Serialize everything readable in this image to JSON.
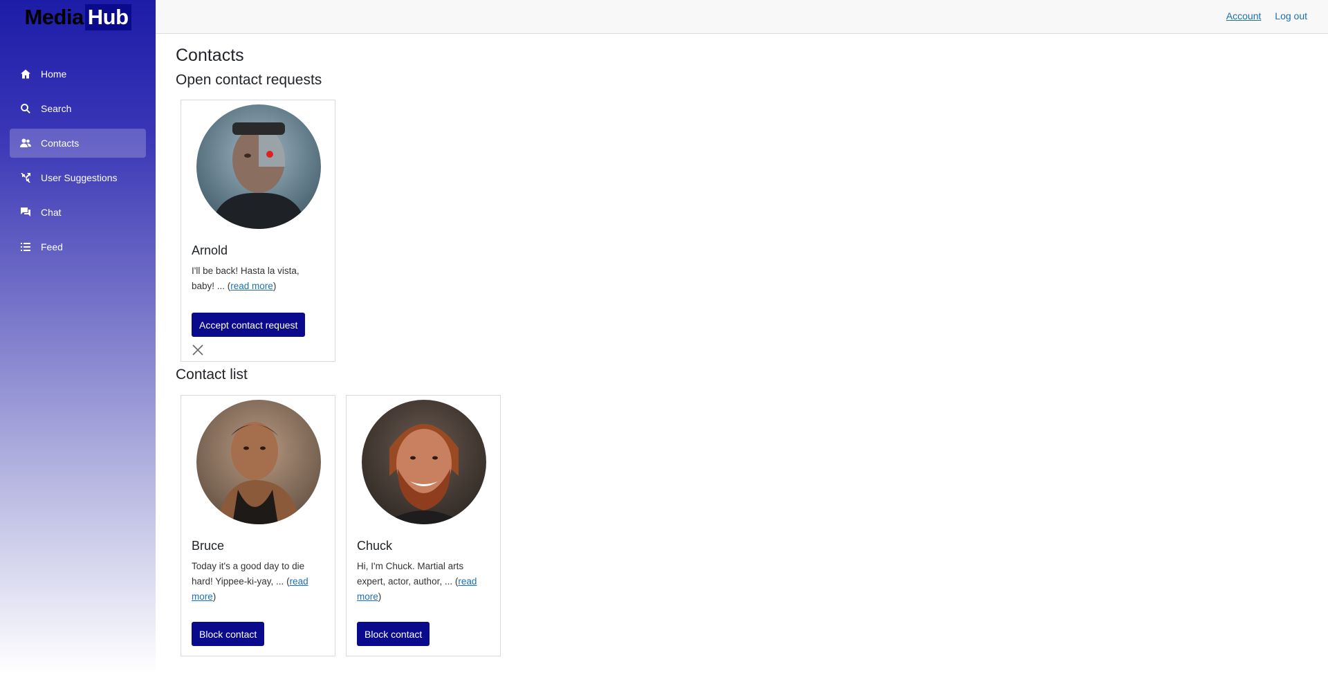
{
  "brand": {
    "part1": "Media",
    "part2": "Hub"
  },
  "sidebar": {
    "items": [
      {
        "label": "Home",
        "icon": "home-icon"
      },
      {
        "label": "Search",
        "icon": "search-icon"
      },
      {
        "label": "Contacts",
        "icon": "contacts-icon",
        "active": true
      },
      {
        "label": "User Suggestions",
        "icon": "suggestions-icon"
      },
      {
        "label": "Chat",
        "icon": "chat-icon"
      },
      {
        "label": "Feed",
        "icon": "feed-icon"
      }
    ]
  },
  "header": {
    "account": "Account",
    "logout": "Log out"
  },
  "main": {
    "title": "Contacts",
    "requests": {
      "heading": "Open contact requests",
      "cards": [
        {
          "name": "Arnold",
          "bio": "I'll be back! Hasta la vista, baby! ... (",
          "read_more": "read more",
          "bio_end": ")",
          "button": "Accept contact request"
        }
      ]
    },
    "contacts": {
      "heading": "Contact list",
      "cards": [
        {
          "name": "Bruce",
          "bio": "Today it's a good day to die hard! Yippee-ki-yay, ... (",
          "read_more": "read more",
          "bio_end": ")",
          "button": "Block contact"
        },
        {
          "name": "Chuck",
          "bio": "Hi, I'm Chuck. Martial arts expert, actor, author, ... (",
          "read_more": "read more",
          "bio_end": ")",
          "button": "Block contact"
        }
      ]
    }
  },
  "colors": {
    "brand_blue": "#0a0a8c",
    "link": "#1a6fb5",
    "sidebar_top": "#1c1ca8"
  }
}
